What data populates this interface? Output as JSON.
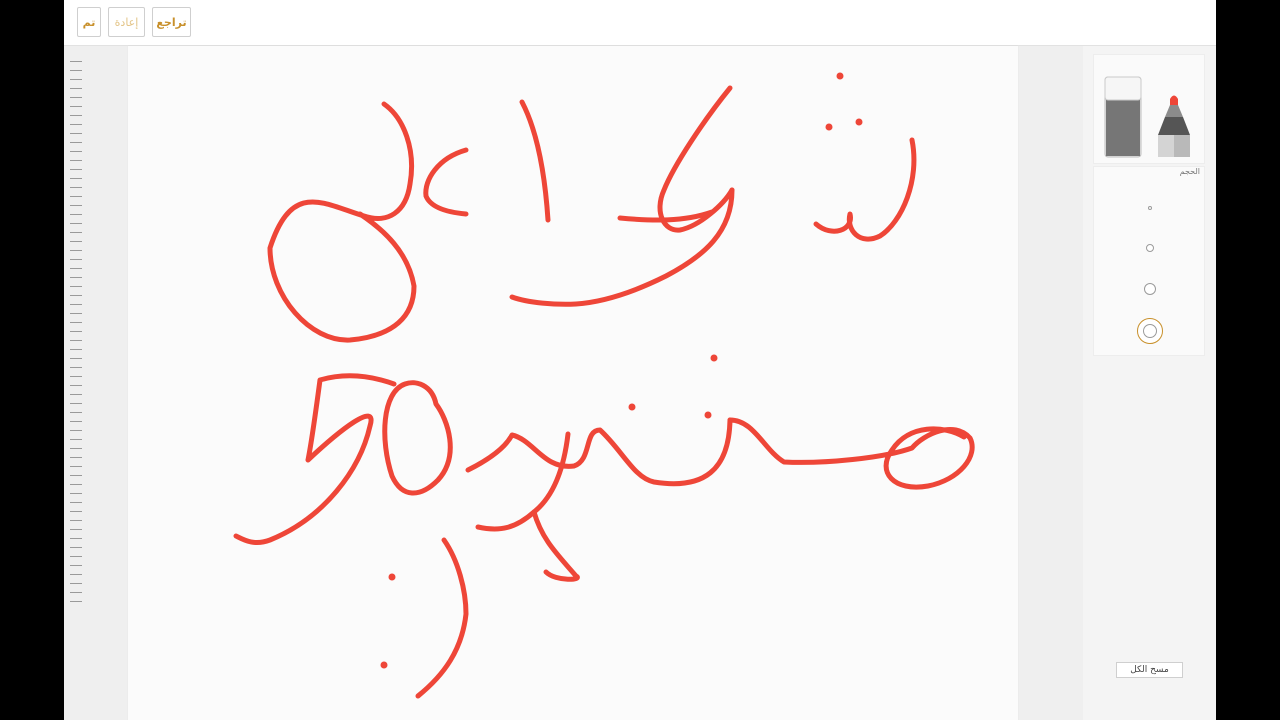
{
  "toolbar": {
    "done_label": "تم",
    "redo_label": "إعادة",
    "undo_label": "تراجع"
  },
  "tools": [
    {
      "name": "eraser",
      "icon": "eraser-icon",
      "selected": false
    },
    {
      "name": "marker",
      "icon": "marker-icon",
      "selected": true
    }
  ],
  "size_panel": {
    "label": "الحجم",
    "options": [
      "xs",
      "s",
      "m",
      "l"
    ],
    "selected": "l"
  },
  "clear_all_label": "مسح الكل",
  "colors": {
    "ink": "#ee4638",
    "accent": "#c8902b"
  }
}
